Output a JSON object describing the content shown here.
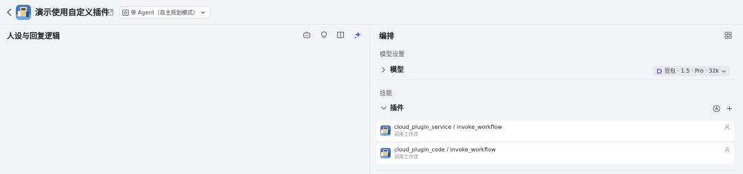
{
  "header": {
    "back_icon": "chevron-left-icon",
    "title": "演示使用自定义插件",
    "mode_label": "单 Agent（自主规划模式）"
  },
  "left": {
    "title": "人设与回复逻辑",
    "tools": [
      "bot-icon",
      "lightbulb-icon",
      "split-view-icon",
      "sparkle-icon"
    ]
  },
  "right": {
    "title": "编排",
    "model_section": "模型设置",
    "model_row": "模型",
    "model_value": "豆包 · 1.5 · Pro · 32k",
    "skills_section": "技能",
    "plugins_row": "插件",
    "plugins": [
      {
        "name": "cloud_plugin_service / invoke_workflow",
        "desc": "调用工作流"
      },
      {
        "name": "cloud_plugin_code / invoke_workflow",
        "desc": "调用工作流"
      }
    ]
  },
  "colors": {
    "accent": "#4d53e8",
    "background": "#f3f4f7",
    "card": "#ffffff"
  }
}
